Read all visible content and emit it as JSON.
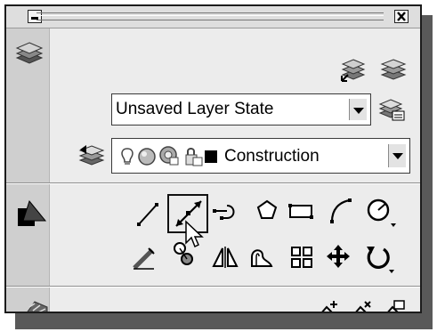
{
  "panel": {
    "titlebar": {
      "minimize_icon": "minimize-icon",
      "close_icon": "close-icon"
    },
    "layers": {
      "section_icon": "layers-icon",
      "layer_state": "Unsaved Layer State",
      "current_layer": "Construction",
      "current_layer_color": "#000000",
      "tools": [
        "make-layer-current-icon",
        "layer-isolate-icon",
        "layer-states-manager-icon",
        "layer-properties-icon",
        "layer-on-icon",
        "layer-freeze-icon",
        "layer-viewport-freeze-icon",
        "layer-lock-icon"
      ]
    },
    "draw": {
      "section_icon": "draw-2d-icon",
      "row1": [
        "line-icon",
        "construction-line-icon",
        "polyline-icon",
        "polygon-icon",
        "rectangle-icon",
        "arc-icon",
        "circle-icon"
      ],
      "row2": [
        "erase-icon",
        "copy-icon",
        "mirror-icon",
        "offset-icon",
        "array-icon",
        "move-icon",
        "rotate-icon"
      ],
      "highlighted_tool": "construction-line-icon"
    },
    "next_section": {
      "section_icon": "hatch-icon",
      "tools": [
        "add-tool-icon",
        "remove-tool-icon",
        "properties-tool-icon"
      ]
    }
  }
}
